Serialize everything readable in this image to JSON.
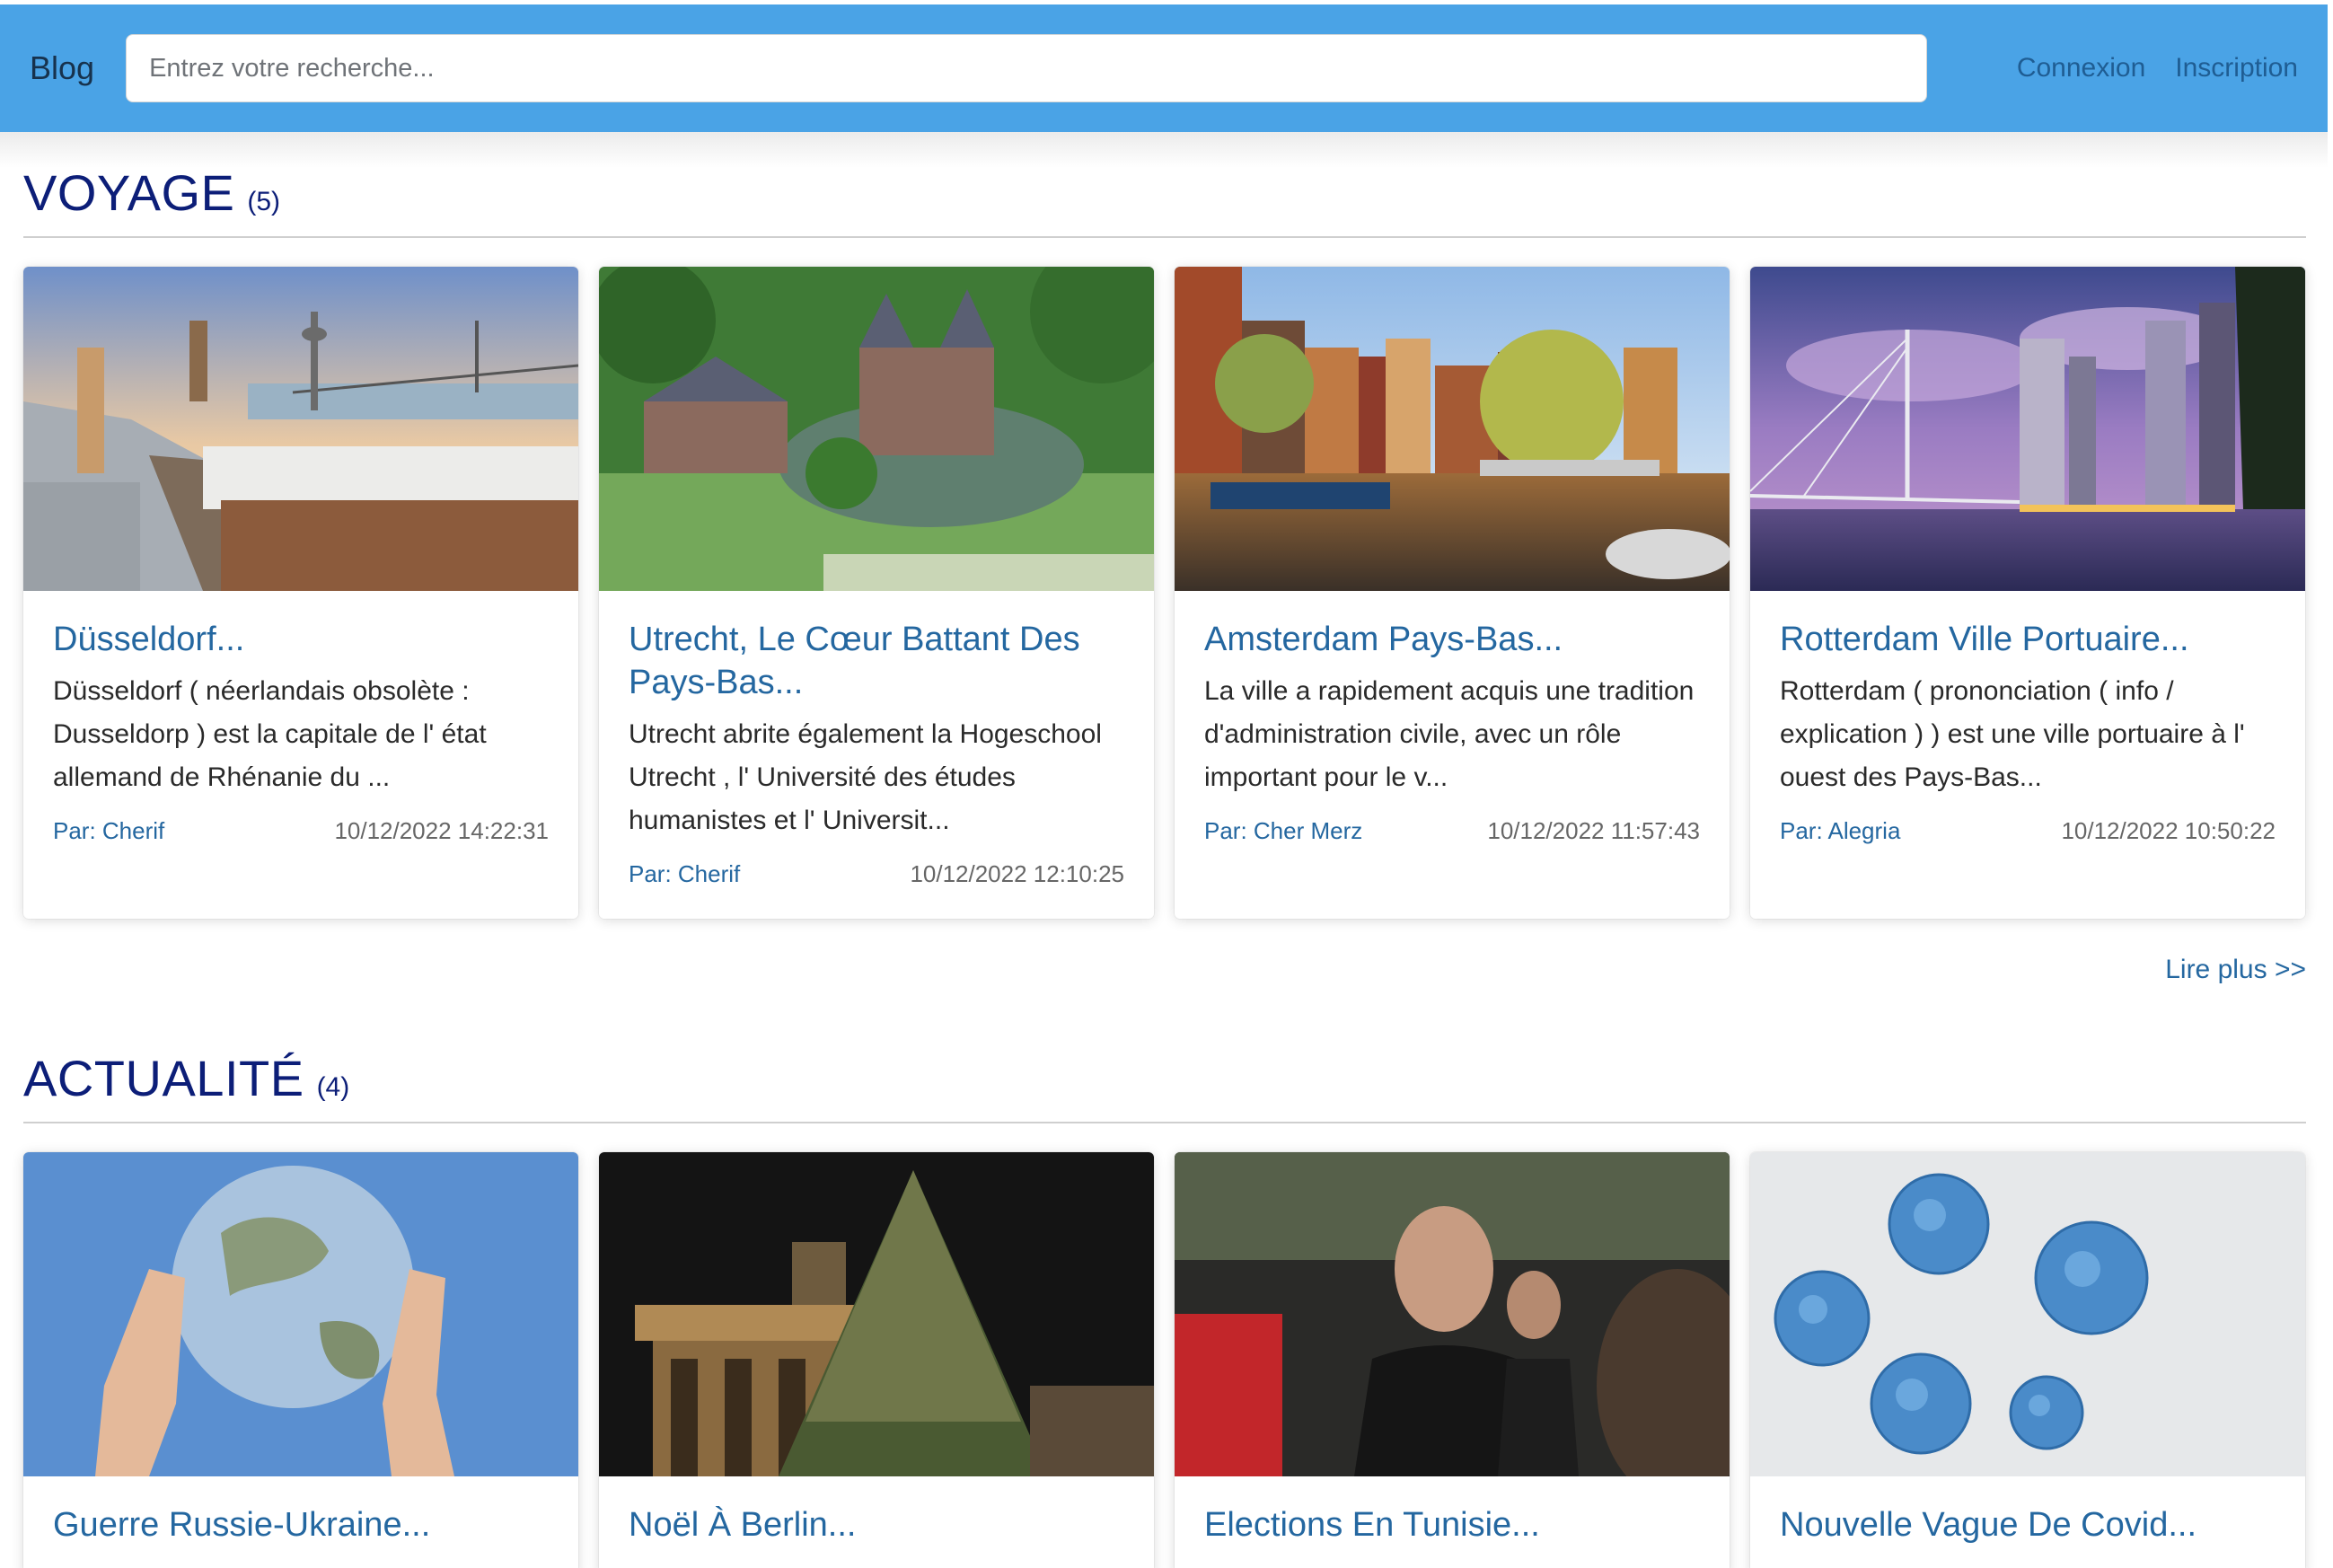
{
  "header": {
    "brand": "Blog",
    "search_placeholder": "Entrez votre recherche...",
    "login": "Connexion",
    "signup": "Inscription"
  },
  "sections": [
    {
      "title": "VOYAGE",
      "count": "(5)",
      "read_more": "Lire plus >>",
      "cards": [
        {
          "image": "dusseldorf-riverside-photo",
          "title": "Düsseldorf...",
          "text": "Düsseldorf ( néerlandais obsolète : Dusseldorp ) est la capitale de l' état allemand de Rhénanie du ...",
          "author": "Par: Cherif",
          "date": "10/12/2022 14:22:31"
        },
        {
          "image": "castle-de-haar-utrecht-photo",
          "title": "Utrecht, Le Cœur Battant Des Pays-Bas...",
          "text": "Utrecht abrite également la Hogeschool Utrecht , l' Université des études humanistes et l' Universit...",
          "author": "Par: Cherif",
          "date": "10/12/2022 12:10:25"
        },
        {
          "image": "amsterdam-canal-photo",
          "title": "Amsterdam Pays-Bas...",
          "text": "La ville a rapidement acquis une tradition d'administration civile, avec un rôle important pour le v...",
          "author": "Par: Cher Merz",
          "date": "10/12/2022 11:57:43"
        },
        {
          "image": "rotterdam-erasmus-bridge-photo",
          "title": "Rotterdam Ville Portuaire...",
          "text": "Rotterdam ( prononciation ( info / explication ) ) est une ville portuaire à l' ouest des Pays-Bas...",
          "author": "Par: Alegria",
          "date": "10/12/2022 10:50:22"
        }
      ]
    },
    {
      "title": "ACTUALITÉ",
      "count": "(4)",
      "cards": [
        {
          "image": "hands-holding-globe-photo",
          "title": "Guerre Russie-Ukraine..."
        },
        {
          "image": "brandenburg-gate-christmas-tree-photo",
          "title": "Noël À Berlin..."
        },
        {
          "image": "tunisia-president-photo",
          "title": "Elections En Tunisie..."
        },
        {
          "image": "coronavirus-particles-photo",
          "title": "Nouvelle Vague De Covid..."
        }
      ]
    }
  ]
}
